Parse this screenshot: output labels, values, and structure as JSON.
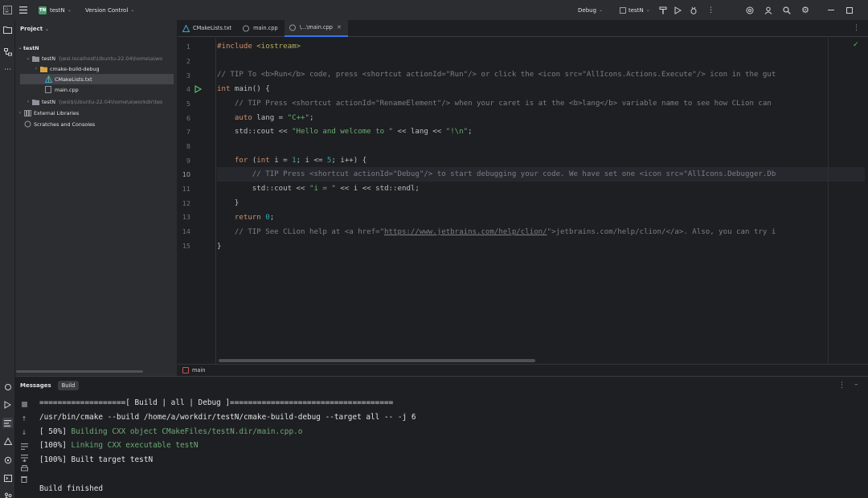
{
  "titlebar": {
    "project_badge": "TN",
    "project_name": "testN",
    "vcs_label": "Version Control",
    "run_config": "Debug",
    "target_name": "testN"
  },
  "project_panel": {
    "title": "Project",
    "tree": [
      {
        "label": "testN",
        "path": ""
      },
      {
        "label": "testN",
        "path": "\\\\wsl.localhost\\Ubuntu-22.04\\home\\a\\wo"
      },
      {
        "label": "cmake-build-debug",
        "path": ""
      },
      {
        "label": "CMakeLists.txt",
        "path": ""
      },
      {
        "label": "main.cpp",
        "path": ""
      },
      {
        "label": "testN",
        "path": "\\\\wsl$\\Ubuntu-22.04\\home\\a\\workdir\\tes"
      },
      {
        "label": "External Libraries",
        "path": ""
      },
      {
        "label": "Scratches and Consoles",
        "path": ""
      }
    ]
  },
  "editor": {
    "tabs": [
      "CMakeLists.txt",
      "main.cpp",
      "\\...\\main.cpp"
    ],
    "line_numbers": [
      "1",
      "2",
      "3",
      "4",
      "5",
      "6",
      "7",
      "8",
      "9",
      "10",
      "11",
      "12",
      "13",
      "14",
      "15"
    ],
    "lines": {
      "l1_include": "#include ",
      "l1_header": "<iostream>",
      "l3": "// TIP To <b>Run</b> code, press <shortcut actionId=\"Run\"/> or click the <icon src=\"AllIcons.Actions.Execute\"/> icon in the gut",
      "l4_kw": "int",
      "l4_rest": " main() {",
      "l5": "    // TIP Press <shortcut actionId=\"RenameElement\"/> when your caret is at the <b>lang</b> variable name to see how CLion can",
      "l6_indent": "    ",
      "l6_kw": "auto",
      "l6_mid": " lang = ",
      "l6_str": "\"C++\"",
      "l6_end": ";",
      "l7_start": "    std::cout << ",
      "l7_str1": "\"Hello and welcome to \"",
      "l7_mid": " << lang << ",
      "l7_str2": "\"!\\n\"",
      "l7_end": ";",
      "l9_indent": "    ",
      "l9_for": "for",
      "l9_a": " (",
      "l9_int": "int",
      "l9_b": " i = ",
      "l9_n1": "1",
      "l9_c": "; i <= ",
      "l9_n5": "5",
      "l9_d": "; i++) {",
      "l10": "        // TIP Press <shortcut actionId=\"Debug\"/> to start debugging your code. We have set one <icon src=\"AllIcons.Debugger.Db",
      "l11_start": "        std::cout << ",
      "l11_str": "\"i = \"",
      "l11_end": " << i << std::endl;",
      "l12": "    }",
      "l13_indent": "    ",
      "l13_kw": "return",
      "l13_sp": " ",
      "l13_num": "0",
      "l13_end": ";",
      "l14_a": "    // TIP See CLion help at <a href=\"",
      "l14_link": "https://www.jetbrains.com/help/clion/",
      "l14_b": "\">jetbrains.com/help/clion/</a>. Also, you can try i",
      "l15": "}"
    },
    "breadcrumb": "main"
  },
  "build_panel": {
    "title": "Messages",
    "tab": "Build",
    "output": [
      "===================[ Build | all | Debug ]====================================",
      "/usr/bin/cmake --build /home/a/workdir/testN/cmake-build-debug --target all -- -j 6",
      "[ 50%] Building CXX object CMakeFiles/testN.dir/main.cpp.o",
      "[100%] Linking CXX executable testN",
      "[100%] Built target testN",
      "Build finished"
    ]
  },
  "colors": {
    "keyword": "#cf8e6d",
    "string": "#6aab73",
    "number": "#2aacb8",
    "comment": "#7a7e85",
    "accent": "#3574f0"
  }
}
